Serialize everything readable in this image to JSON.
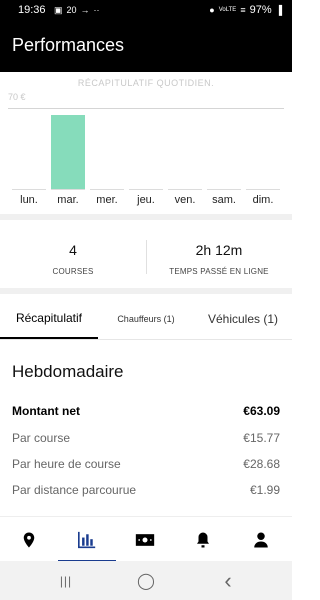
{
  "status_bar": {
    "time": "19:36",
    "left_glyphs": [
      "▣",
      "20",
      "→",
      "··"
    ],
    "right_glyphs": [
      "●",
      "VoLTE",
      "≡",
      "▐"
    ],
    "battery": "97%"
  },
  "app_bar": {
    "title": "Performances"
  },
  "chart_data": {
    "type": "bar",
    "title": "RÉCAPITULATIF QUOTIDIEN.",
    "y_tick_label": "70 €",
    "categories": [
      "lun.",
      "mar.",
      "mer.",
      "jeu.",
      "ven.",
      "sam.",
      "dim."
    ],
    "values": [
      0,
      63.09,
      0,
      0,
      0,
      0,
      0
    ],
    "ylim": [
      0,
      70
    ],
    "colors": {
      "bar": "#86dcbb"
    }
  },
  "stats": [
    {
      "value": "4",
      "label": "COURSES"
    },
    {
      "value": "2h 12m",
      "label": "TEMPS PASSÉ EN LIGNE"
    }
  ],
  "tabs": [
    {
      "label": "Récapitulatif",
      "active": true
    },
    {
      "label": "Chauffeurs (1)",
      "active": false
    },
    {
      "label": "Véhicules (1)",
      "active": false
    }
  ],
  "summary": {
    "heading": "Hebdomadaire",
    "rows": [
      {
        "label": "Montant net",
        "value": "€63.09"
      },
      {
        "label": "Par course",
        "value": "€15.77"
      },
      {
        "label": "Par heure de course",
        "value": "€28.68"
      },
      {
        "label": "Par distance parcourue",
        "value": "€1.99"
      }
    ]
  },
  "bottom_nav": [
    {
      "icon": "location-pin-icon",
      "active": false
    },
    {
      "icon": "bar-chart-icon",
      "active": true
    },
    {
      "icon": "money-icon",
      "active": false
    },
    {
      "icon": "bell-icon",
      "active": false
    },
    {
      "icon": "profile-icon",
      "active": false
    }
  ],
  "system_nav": [
    {
      "icon": "recent-apps-icon",
      "glyph": "|||"
    },
    {
      "icon": "home-icon",
      "glyph": "◯"
    },
    {
      "icon": "back-icon",
      "glyph": "‹"
    }
  ]
}
